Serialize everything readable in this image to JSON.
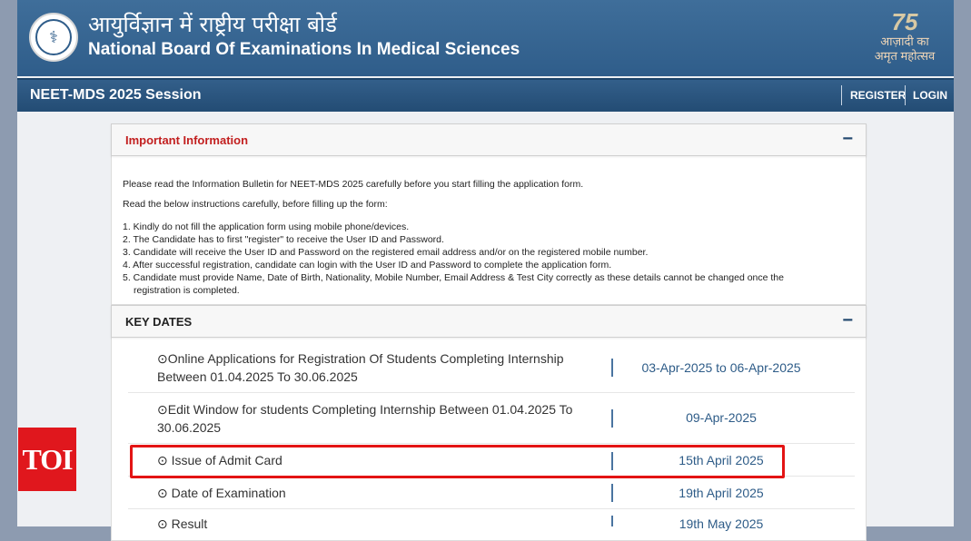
{
  "header": {
    "title_hindi": "आयुर्विज्ञान में राष्ट्रीय परीक्षा बोर्ड",
    "title_english": "National Board Of Examinations In Medical Sciences",
    "logo_icon": "nbems-emblem-icon",
    "azadi_logo": {
      "number": "75",
      "line1": "आज़ादी का",
      "line2": "अमृत महोत्सव"
    }
  },
  "session_bar": {
    "title": "NEET-MDS 2025 Session",
    "register_label": "REGISTER",
    "login_label": "LOGIN"
  },
  "important_info": {
    "heading": "Important Information",
    "toggle": "−",
    "intro1": "Please read the Information Bulletin for NEET-MDS 2025 carefully before you start filling the application form.",
    "intro2": "Read the below instructions carefully, before filling up the form:",
    "items": [
      "1. Kindly do not fill the application form using mobile phone/devices.",
      "2. The Candidate has to first \"register\" to receive the User ID and Password.",
      "3. Candidate will receive the User ID and Password on the registered email address and/or on the registered mobile number.",
      "4. After successful registration, candidate can login with the User ID and Password to complete the application form.",
      "5. Candidate must provide Name, Date of Birth, Nationality, Mobile Number, Email Address & Test City correctly as these details cannot be changed once the",
      "registration is completed."
    ]
  },
  "key_dates": {
    "heading": "KEY DATES",
    "toggle": "−",
    "rows": [
      {
        "label": "Online Applications for Registration Of Students Completing Internship Between 01.04.2025 To 30.06.2025",
        "date": "03-Apr-2025 to 06-Apr-2025"
      },
      {
        "label": "Edit Window for students Completing Internship Between 01.04.2025 To 30.06.2025",
        "date": "09-Apr-2025"
      },
      {
        "label": " Issue of Admit Card",
        "date": "15th April 2025"
      },
      {
        "label": " Date of Examination",
        "date": "19th April 2025"
      },
      {
        "label": " Result",
        "date": "19th May 2025"
      }
    ]
  },
  "watermark": {
    "text": "TOI"
  },
  "colors": {
    "header_blue": "#2f5d8a",
    "important_heading_red": "#c21f1f",
    "date_blue": "#2e5c88",
    "highlight_red": "#e31414",
    "toi_red": "#e0171d"
  }
}
